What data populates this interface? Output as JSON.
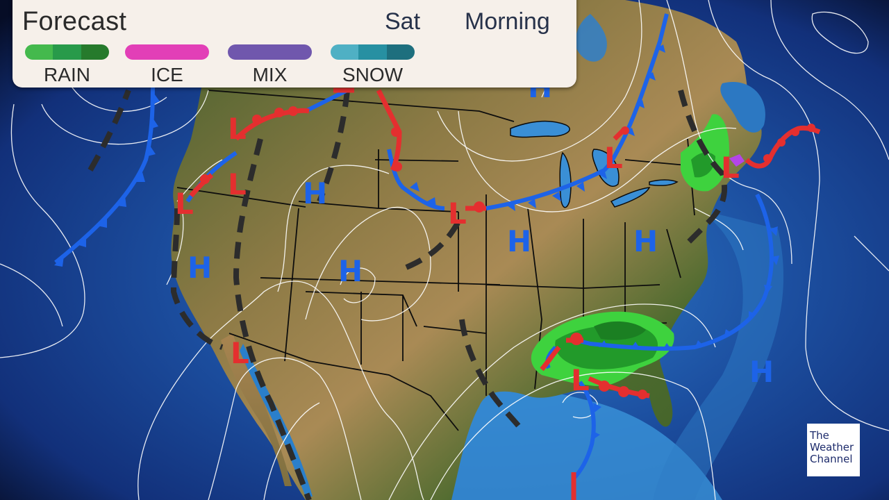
{
  "legend": {
    "title": "Forecast",
    "day": "Sat",
    "time_of_day": "Morning",
    "items": [
      {
        "label": "RAIN",
        "colors": [
          "#44b94d",
          "#289a4a",
          "#267a2c"
        ]
      },
      {
        "label": "ICE",
        "colors": [
          "#e23fb7"
        ]
      },
      {
        "label": "MIX",
        "colors": [
          "#7057ad"
        ]
      },
      {
        "label": "SNOW",
        "colors": [
          "#4fb0c4",
          "#2790a2",
          "#1e6f7e"
        ]
      }
    ]
  },
  "colors": {
    "cold_front": "#1d63e8",
    "warm_front": "#e42f2f",
    "trough": "#2c2c2c",
    "isobar": "#ffffff",
    "high_marker": "#1d63e8",
    "low_marker": "#e42f2f"
  },
  "pressure_centers": {
    "highs": [
      "H",
      "H",
      "H",
      "H",
      "H",
      "H",
      "H"
    ],
    "lows": [
      "L",
      "L",
      "L",
      "L",
      "L",
      "L",
      "L",
      "L"
    ]
  },
  "branding": {
    "logo_line1": "The",
    "logo_line2": "Weather",
    "logo_line3": "Channel"
  }
}
